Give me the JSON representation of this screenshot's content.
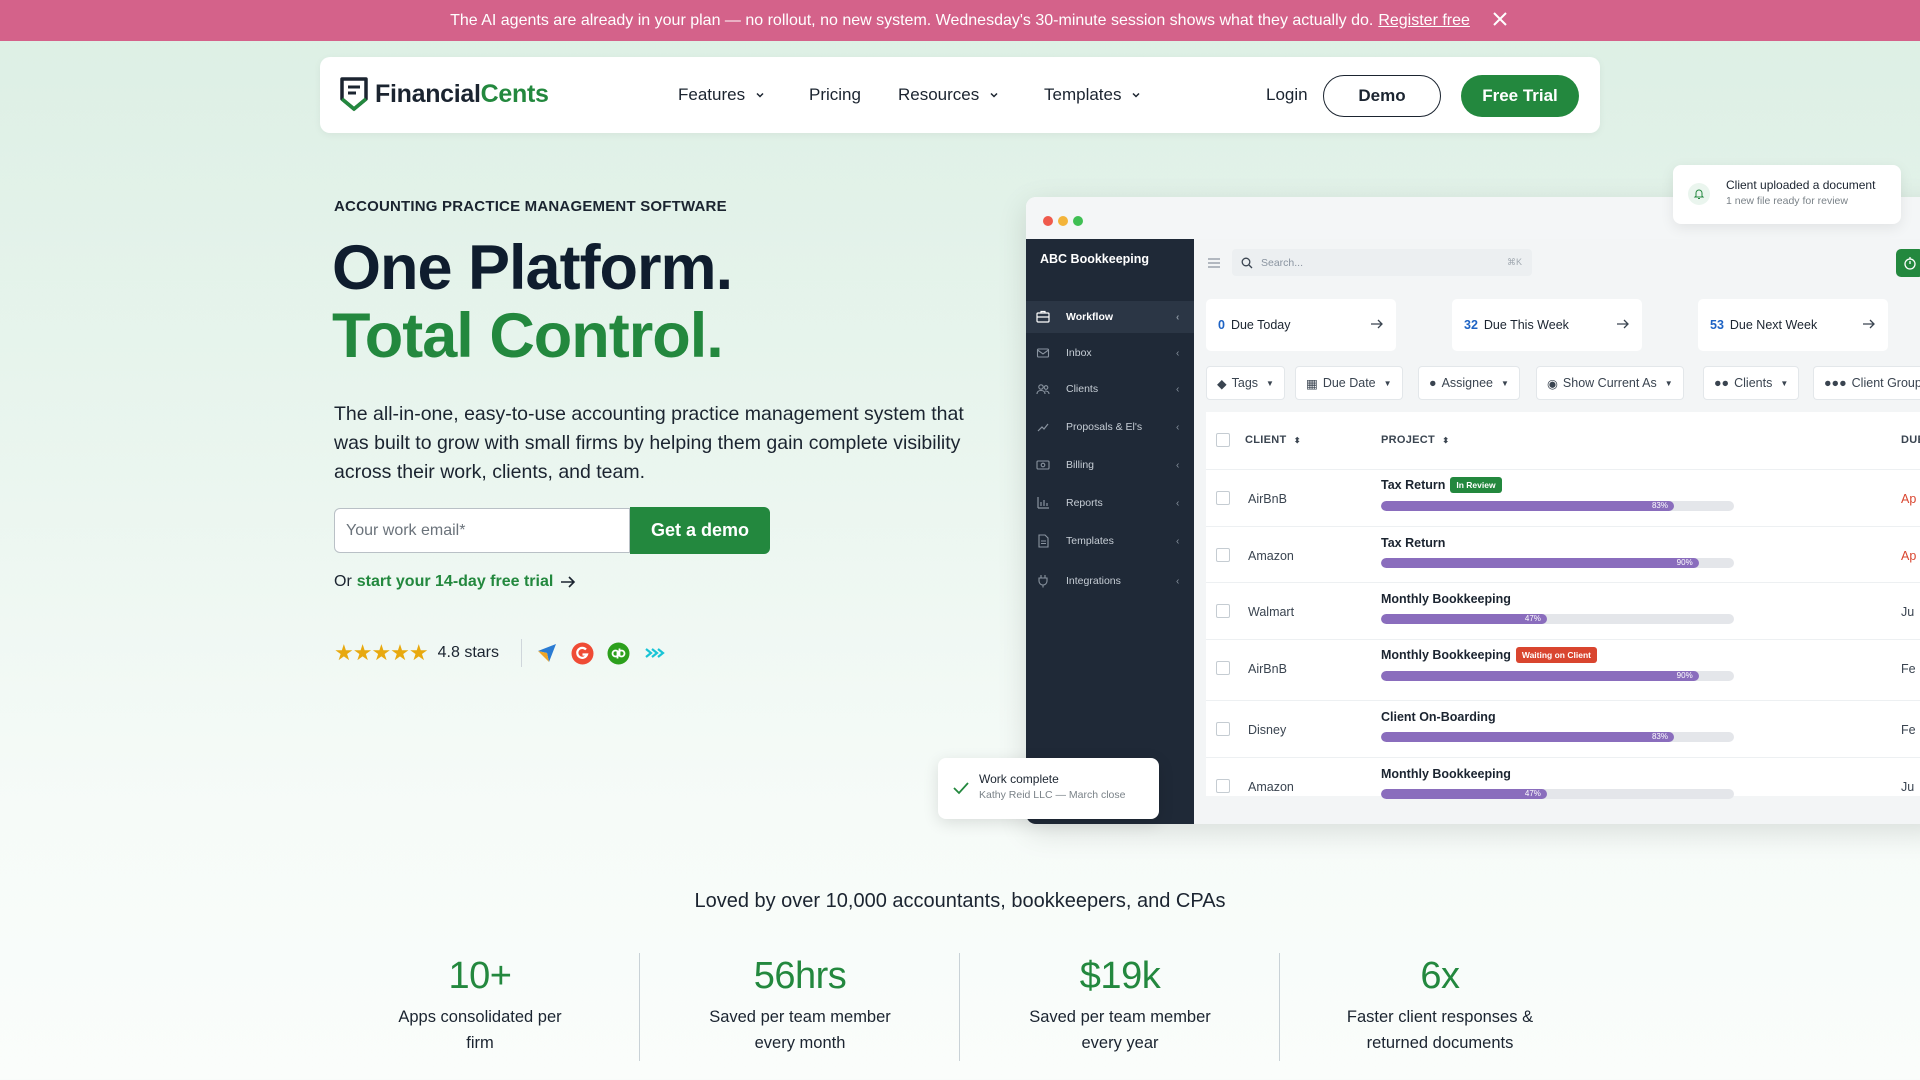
{
  "banner": {
    "text": "The AI agents are already in your plan — no rollout, no new system. Wednesday's 30-minute session shows what they actually do.",
    "link": "Register free"
  },
  "nav": {
    "brand_dark": "Financial",
    "brand_green": "Cents",
    "features": "Features",
    "pricing": "Pricing",
    "resources": "Resources",
    "templates": "Templates",
    "login": "Login",
    "demo": "Demo",
    "free_trial": "Free Trial"
  },
  "hero": {
    "eyebrow": "ACCOUNTING PRACTICE MANAGEMENT SOFTWARE",
    "title_line1": "One Platform.",
    "title_line2": "Total Control.",
    "description": "The all-in-one, easy-to-use accounting practice management system that was built to grow with small firms by helping them gain complete visibility across their work, clients, and team.",
    "email_placeholder": "Your work email*",
    "cta": "Get a demo",
    "or": "Or",
    "trial_link": "start your 14-day free trial",
    "stars": "★★★★★",
    "stars_text": "4.8 stars"
  },
  "notification": {
    "title": "Client uploaded a document",
    "subtitle": "1 new file ready for review"
  },
  "app": {
    "firm": "ABC Bookkeeping",
    "search_placeholder": "Search...",
    "search_shortcut": "⌘K",
    "sidebar": [
      {
        "label": "Workflow",
        "icon": "workflow-icon"
      },
      {
        "label": "Inbox",
        "icon": "inbox-icon"
      },
      {
        "label": "Clients",
        "icon": "clients-icon"
      },
      {
        "label": "Proposals & El's",
        "icon": "proposals-icon"
      },
      {
        "label": "Billing",
        "icon": "billing-icon"
      },
      {
        "label": "Reports",
        "icon": "reports-icon"
      },
      {
        "label": "Templates",
        "icon": "templates-icon"
      },
      {
        "label": "Integrations",
        "icon": "integrations-icon"
      }
    ],
    "cards": [
      {
        "count": "0",
        "label": "Due Today"
      },
      {
        "count": "32",
        "label": "Due This Week"
      },
      {
        "count": "53",
        "label": "Due Next Week"
      }
    ],
    "filters": [
      "Tags",
      "Due Date",
      "Assignee",
      "Show Current As",
      "Clients",
      "Client Group"
    ],
    "columns": {
      "client": "CLIENT",
      "project": "PROJECT",
      "due": "DUE"
    },
    "rows": [
      {
        "client": "AirBnB",
        "project": "Tax Return",
        "badge": "In Review",
        "badge_color": "#23883e",
        "progress": 83,
        "progress_label": "83%",
        "due": "Ap",
        "due_color": "#d9452f"
      },
      {
        "client": "Amazon",
        "project": "Tax Return",
        "badge": "",
        "badge_color": "",
        "progress": 90,
        "progress_label": "90%",
        "due": "Ap",
        "due_color": "#d9452f"
      },
      {
        "client": "Walmart",
        "project": "Monthly Bookkeeping",
        "badge": "",
        "badge_color": "",
        "progress": 47,
        "progress_label": "47%",
        "due": "Ju",
        "due_color": "#3a4450"
      },
      {
        "client": "AirBnB",
        "project": "Monthly Bookkeeping",
        "badge": "Waiting on Client",
        "badge_color": "#d9452f",
        "progress": 90,
        "progress_label": "90%",
        "due": "Fe",
        "due_color": "#3a4450"
      },
      {
        "client": "Disney",
        "project": "Client On-Boarding",
        "badge": "",
        "badge_color": "",
        "progress": 83,
        "progress_label": "83%",
        "due": "Fe",
        "due_color": "#3a4450"
      },
      {
        "client": "Amazon",
        "project": "Monthly Bookkeeping",
        "badge": "",
        "badge_color": "",
        "progress": 47,
        "progress_label": "47%",
        "due": "Ju",
        "due_color": "#3a4450"
      }
    ]
  },
  "work_complete": {
    "title": "Work complete",
    "subtitle": "Kathy Reid LLC — March close"
  },
  "social": {
    "loved": "Loved by over 10,000 accountants, bookkeepers, and CPAs"
  },
  "stats": [
    {
      "value": "10+",
      "label": "Apps consolidated per firm"
    },
    {
      "value": "56hrs",
      "label": "Saved per team member every month"
    },
    {
      "value": "$19k",
      "label": "Saved per team member every year"
    },
    {
      "value": "6x",
      "label": "Faster client responses & returned documents"
    }
  ],
  "colors": {
    "brand_green": "#23883e",
    "banner_pink": "#d4628a",
    "progress_purple": "#8a6dbd",
    "link_blue": "#1e63c4"
  }
}
